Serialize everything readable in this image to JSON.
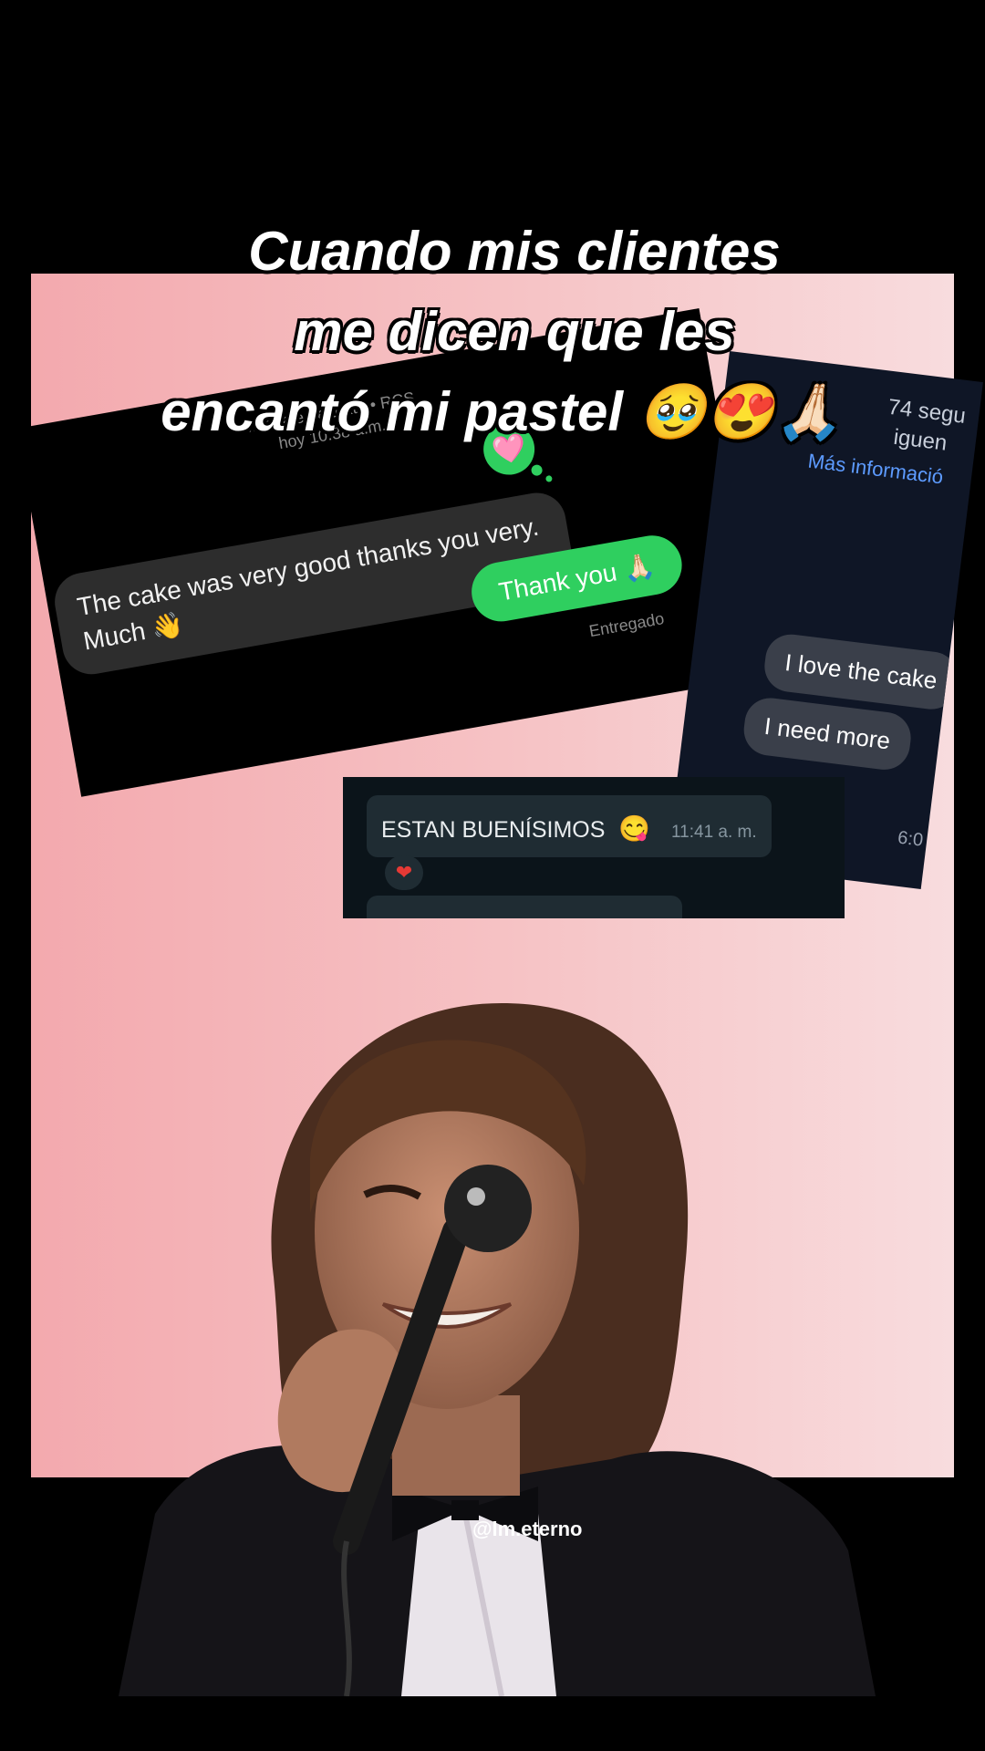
{
  "caption": {
    "line1": "Cuando mis clientes",
    "line2": "me dicen que les",
    "line3": "encantó mi pastel 🥹😍🙏🏻"
  },
  "rcs_chat": {
    "meta_line1": "Mensaje de texto • RCS",
    "meta_line2": "hoy 10:38 a.m.",
    "reaction_emoji": "🩷",
    "incoming_message": "The cake  was  very good thanks you very. Much 👋",
    "outgoing_message": "Thank you 🙏🏻",
    "delivery_status": "Entregado",
    "outgoing_color": "#2fcf5f"
  },
  "dark_chat": {
    "followers_line1": "74 segu",
    "followers_line2": "iguen",
    "more_info": "Más informació",
    "message1": "I love the cake",
    "message2": "I need more",
    "time": "6:0"
  },
  "whatsapp_chat": {
    "message": "ESTAN BUENÍSIMOS",
    "emoji": "😋",
    "time": "11:41 a. m.",
    "reaction": "❤"
  },
  "watermark": "@lm.eterno"
}
